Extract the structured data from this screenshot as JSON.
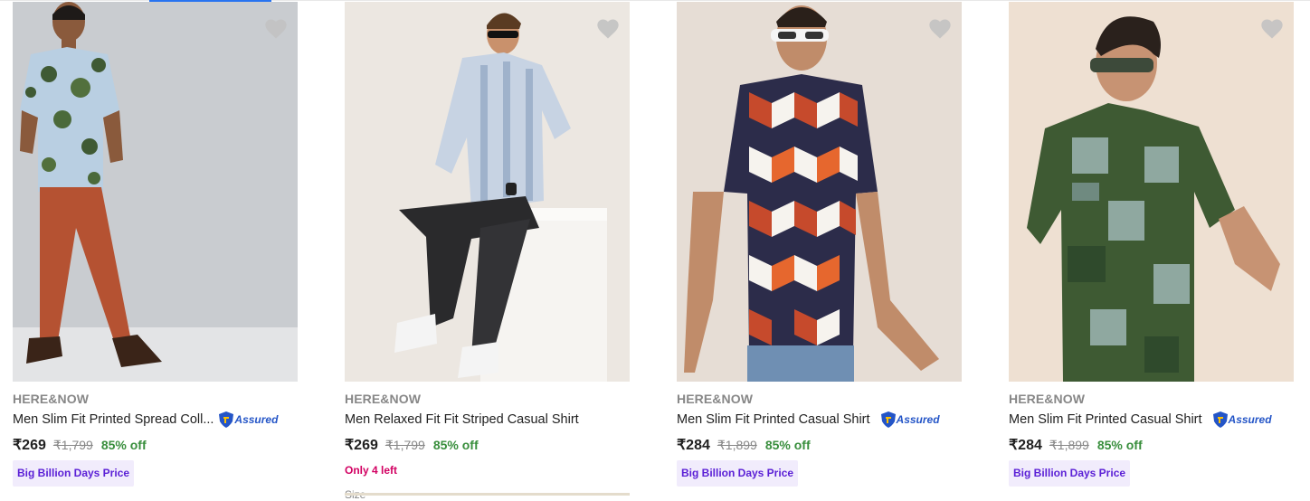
{
  "products": [
    {
      "brand": "HERE&NOW",
      "title": "Men Slim Fit Printed Spread Coll...",
      "assured": true,
      "assured_label": "Assured",
      "price": "₹269",
      "mrp": "₹1,799",
      "discount": "85% off",
      "promo": "Big Billion Days Price",
      "image": "man-floral-shirt-rust-trousers"
    },
    {
      "brand": "HERE&NOW",
      "title": "Men Relaxed Fit Fit Striped Casual Shirt",
      "assured": false,
      "price": "₹269",
      "mrp": "₹1,799",
      "discount": "85% off",
      "stock": "Only 4 left",
      "size_label": "Size",
      "image": "man-striped-shirt-seated"
    },
    {
      "brand": "HERE&NOW",
      "title": "Men Slim Fit Printed Casual Shirt",
      "assured": true,
      "assured_label": "Assured",
      "price": "₹284",
      "mrp": "₹1,899",
      "discount": "85% off",
      "promo": "Big Billion Days Price",
      "image": "man-geometric-shirt"
    },
    {
      "brand": "HERE&NOW",
      "title": "Men Slim Fit Printed Casual Shirt",
      "assured": true,
      "assured_label": "Assured",
      "price": "₹284",
      "mrp": "₹1,899",
      "discount": "85% off",
      "promo": "Big Billion Days Price",
      "image": "man-green-paisley-shirt"
    }
  ],
  "colors": {
    "discount": "#388e3c",
    "promo_text": "#5b20d6",
    "promo_bg": "#f1ecfc",
    "stock": "#d20062",
    "assured": "#2455c7"
  },
  "icons": {
    "wishlist": "heart-icon",
    "assured": "assured-shield-icon"
  }
}
